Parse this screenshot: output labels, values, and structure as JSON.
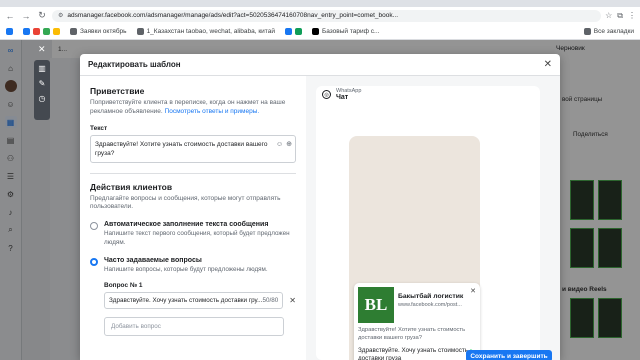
{
  "browser": {
    "url": "adsmanager.facebook.com/adsmanager/manage/ads/edit?act=5020536474160708nav_entry_point=comet_book...",
    "bookmarks": [
      "Заявки октябрь",
      "1_Казахстан taobao, wechat, alibaba, китай",
      "Базовый тариф с...",
      "Все закладки"
    ]
  },
  "background": {
    "tab_label": "1...",
    "draft_label": "Черновик",
    "right_text": "вой страницы",
    "share_label": "Поделиться",
    "reels_label": "и видео Reels"
  },
  "modal": {
    "title": "Редактировать шаблон",
    "greeting": {
      "title": "Приветствие",
      "desc": "Поприветствуйте клиента в переписке, когда он нажмет на ваше рекламное объявление.",
      "link": "Посмотреть ответы и примеры.",
      "text_label": "Текст",
      "text_value": "Здравствуйте! Хотите узнать стоимость доставки вашего груза?"
    },
    "actions": {
      "title": "Действия клиентов",
      "desc": "Предлагайте вопросы и сообщения, которые могут отправлять пользователи.",
      "option1_title": "Автоматическое заполнение текста сообщения",
      "option1_desc": "Напишите текст первого сообщения, который будет предложен людям.",
      "option2_title": "Часто задаваемые вопросы",
      "option2_desc": "Напишите вопросы, которые будут предложены людям.",
      "q1_label": "Вопрос № 1",
      "q1_value": "Здравствуйте. Хочу узнать стоимость доставки гру...",
      "q1_count": "50/80",
      "add_question": "Добавить вопрос"
    },
    "preview": {
      "brand": "WhatsApp",
      "chat": "Чат",
      "logo_text": "BL",
      "business_name": "Бакытбай логистик",
      "business_url": "www.facebook.com/post...",
      "greeting": "Здравствуйте! Хотите узнать стоимость доставки вашего груза?",
      "question": "Здравствуйте. Хочу узнать стоимость доставки груза"
    },
    "save_label": "Сохранить и завершить"
  },
  "colors": {
    "accent": "#1877f2",
    "whatsapp": "#25d366",
    "logo_bg": "#2e7d32"
  }
}
